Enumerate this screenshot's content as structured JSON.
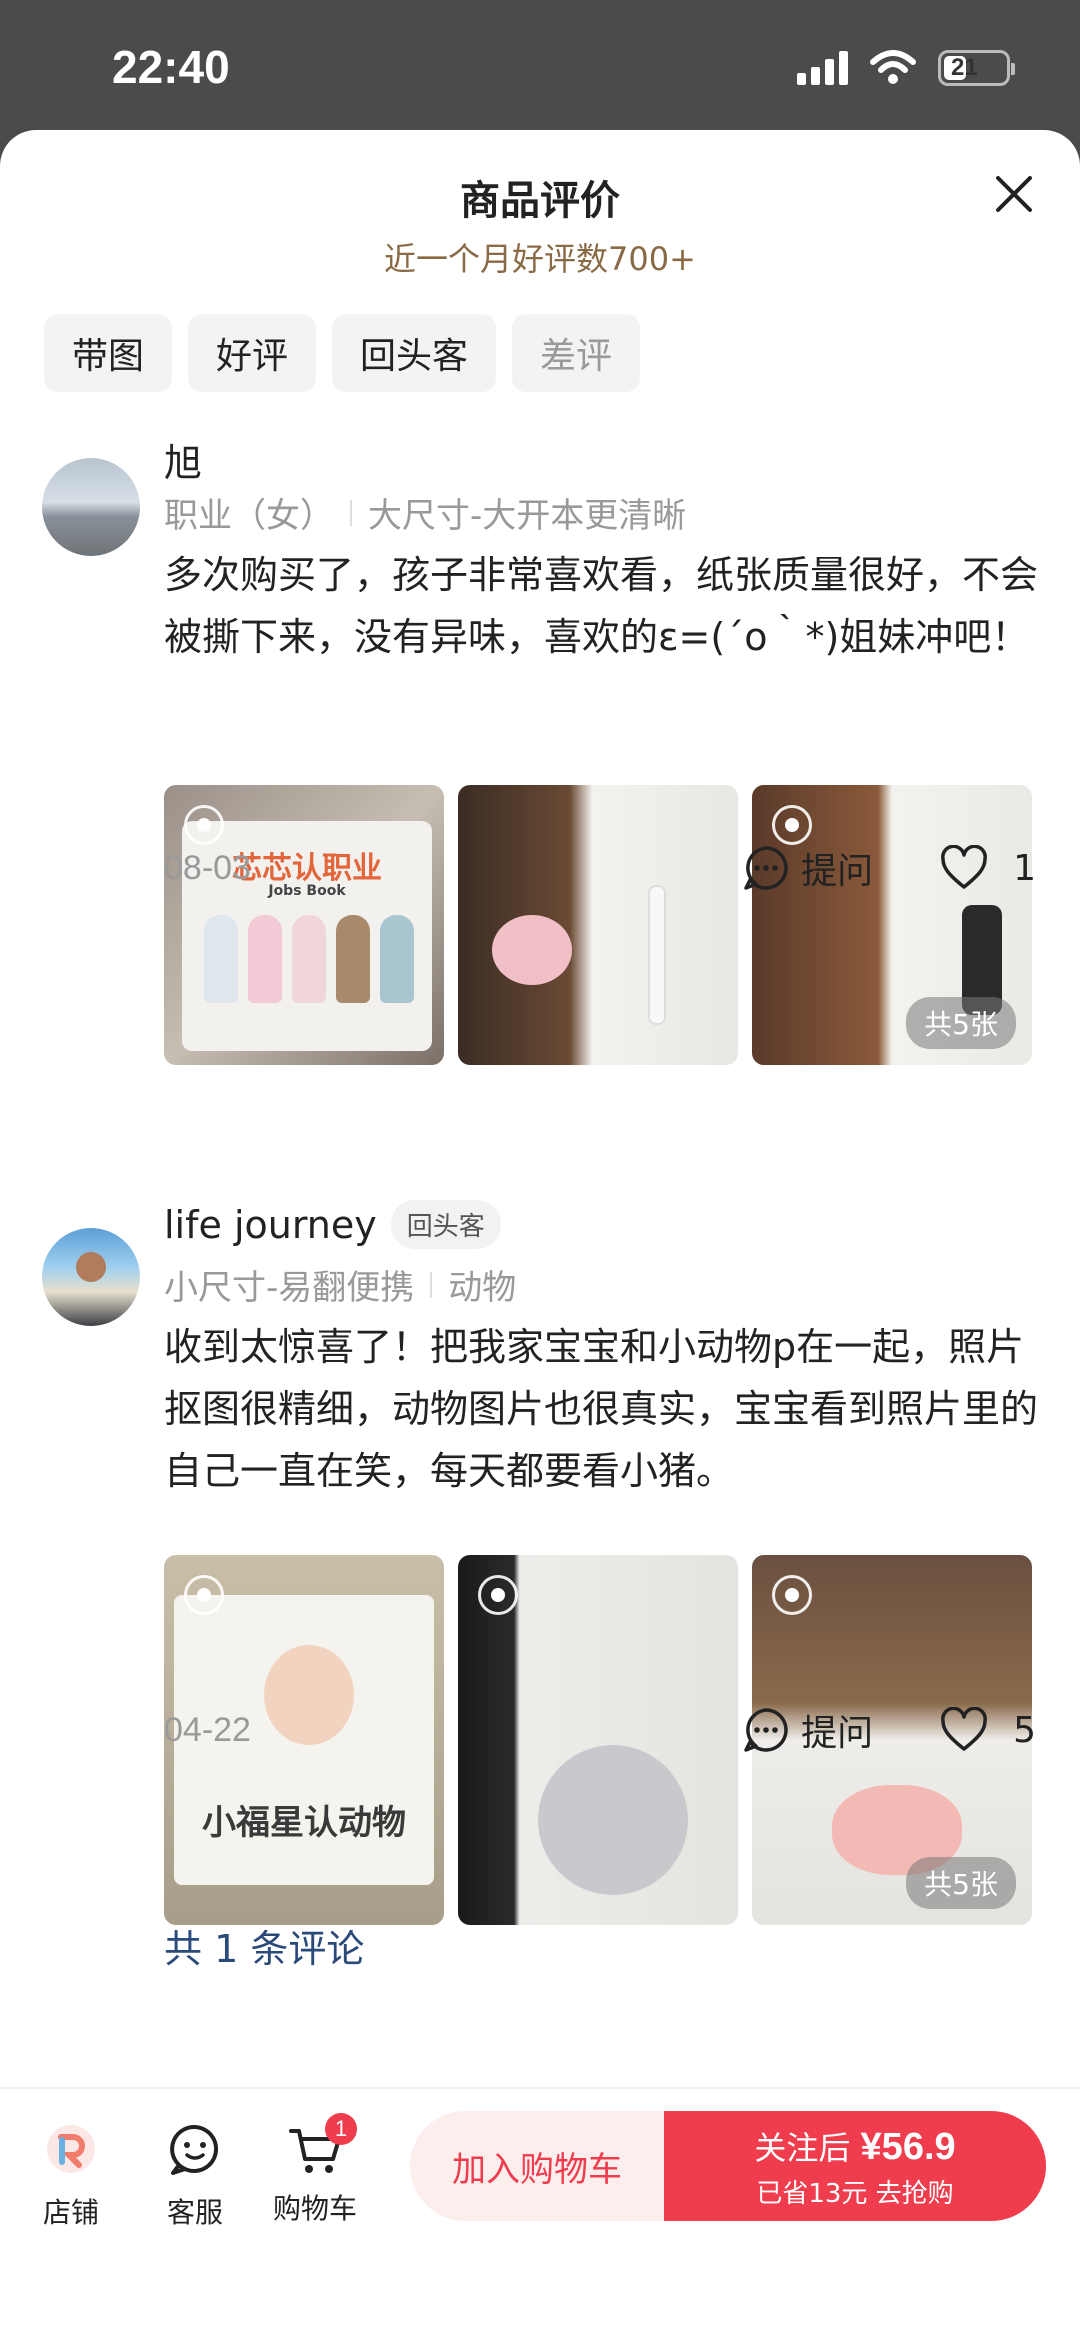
{
  "status_bar": {
    "time": "22:40",
    "battery": "21"
  },
  "header": {
    "title": "商品评价",
    "subtitle": "近一个月好评数700+",
    "filters": [
      "带图",
      "好评",
      "回头客",
      "差评"
    ]
  },
  "reviews": [
    {
      "user": "旭",
      "badge": "",
      "spec": [
        "职业（女）",
        "大尺寸-大开本更清晰"
      ],
      "text": "多次购买了，孩子非常喜欢看，纸张质量很好，不会被撕下来，没有异味，喜欢的ε=(´ο｀*)姐妹冲吧！",
      "photo_book_title": "芯芯认职业",
      "photo_book_sub": "Jobs Book",
      "photo_count": "共5张",
      "date": "08-03",
      "ask_label": "提问",
      "likes": "1"
    },
    {
      "user": "life journey",
      "badge": "回头客",
      "spec": [
        "小尺寸-易翻便携",
        "动物"
      ],
      "text": "收到太惊喜了！把我家宝宝和小动物p在一起，照片抠图很精细，动物图片也很真实，宝宝看到照片里的自己一直在笑，每天都要看小猪。",
      "photo_book_title": "小福星认动物",
      "photo_count": "共5张",
      "date": "04-22",
      "ask_label": "提问",
      "likes": "5"
    }
  ],
  "total_comments": "共 1 条评论",
  "bottom_bar": {
    "shop_label": "店铺",
    "service_label": "客服",
    "cart_label": "购物车",
    "cart_count": "1",
    "add_to_cart": "加入购物车",
    "buy_prefix": "关注后 ",
    "buy_price": "¥56.9",
    "buy_sub": "已省13元 去抢购"
  },
  "colors": {
    "accent": "#ef3d4e",
    "subtitle": "#8a6a45",
    "link": "#2a4a7a"
  }
}
